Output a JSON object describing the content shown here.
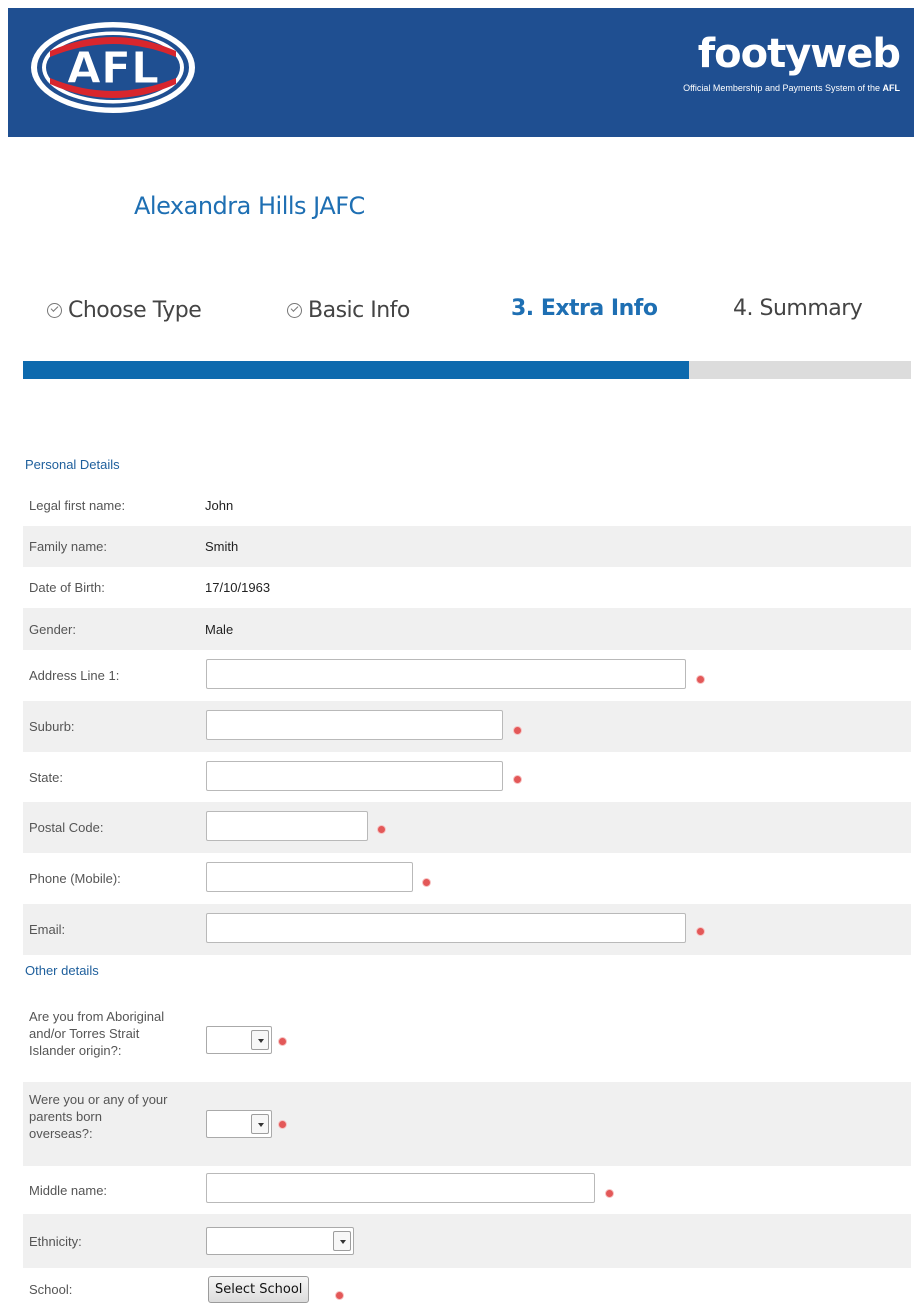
{
  "header": {
    "logo_text": "AFL",
    "brand_title": "footyweb",
    "brand_subtitle_prefix": "Official Membership and Payments System of the ",
    "brand_subtitle_bold": "AFL"
  },
  "club_name": "Alexandra Hills JAFC",
  "steps": [
    {
      "label": "Choose Type",
      "state": "done"
    },
    {
      "label": "Basic Info",
      "state": "done"
    },
    {
      "label": "3. Extra Info",
      "state": "active"
    },
    {
      "label": "4. Summary",
      "state": "pending"
    }
  ],
  "progress_fraction": 0.75,
  "personal": {
    "title": "Personal Details",
    "first_name_label": "Legal first name:",
    "first_name": "John",
    "family_name_label": "Family name:",
    "family_name": "Smith",
    "dob_label": "Date of Birth:",
    "dob": "17/10/1963",
    "gender_label": "Gender:",
    "gender": "Male",
    "address_label": "Address Line 1:",
    "address_value": "",
    "suburb_label": "Suburb:",
    "suburb_value": "",
    "state_label": "State:",
    "state_value": "",
    "postal_label": "Postal Code:",
    "postal_value": "",
    "phone_label": "Phone (Mobile):",
    "phone_value": "",
    "email_label": "Email:",
    "email_value": ""
  },
  "other": {
    "title": "Other details",
    "aboriginal_label_1": "Are you from Aboriginal",
    "aboriginal_label_2": "and/or Torres Strait",
    "aboriginal_label_3": "Islander origin?:",
    "overseas_label_1": "Were you or any of your",
    "overseas_label_2": "parents born",
    "overseas_label_3": "overseas?:",
    "middle_name_label": "Middle name:",
    "middle_name_value": "",
    "ethnicity_label": "Ethnicity:",
    "school_label": "School:",
    "select_school_button": "Select School"
  },
  "colors": {
    "header_bg": "#1f4f91",
    "accent": "#1e6fb3",
    "progress": "#0e6aae",
    "required": "#e35858"
  }
}
